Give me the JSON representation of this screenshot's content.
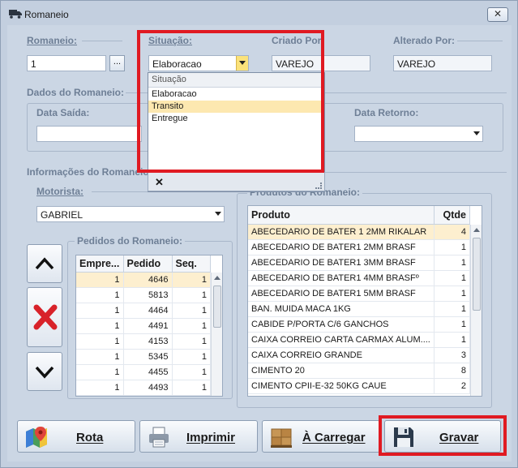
{
  "window": {
    "title": "Romaneio",
    "close_glyph": "✕"
  },
  "fields": {
    "romaneio": {
      "label": "Romaneio:",
      "value": "1",
      "button": "..."
    },
    "situacao": {
      "label": "Situação:",
      "value": "Elaboracao"
    },
    "criado_por": {
      "label": "Criado Por:",
      "value": "VAREJO"
    },
    "alterado_por": {
      "label": "Alterado Por:",
      "value": "VAREJO"
    }
  },
  "dados": {
    "title": "Dados do Romaneio:",
    "data_saida_label": "Data Saída:",
    "data_retorno_label": "Data Retorno:"
  },
  "situacao_dropdown": {
    "header": "Situação",
    "options": [
      "Elaboracao",
      "Transito",
      "Entregue"
    ],
    "highlighted": "Transito",
    "close_glyph": "✕"
  },
  "info": {
    "title": "Informações do Romaneio:",
    "motorista_label": "Motorista:",
    "motorista_value": "GABRIEL",
    "pedidos_label": "Pedidos do Romaneio:",
    "produtos_label": "Produtos do Romaneio:"
  },
  "pedidos": {
    "columns": [
      "Empre...",
      "Pedido",
      "Seq."
    ],
    "rows": [
      [
        "1",
        "4646",
        "1"
      ],
      [
        "1",
        "5813",
        "1"
      ],
      [
        "1",
        "4464",
        "1"
      ],
      [
        "1",
        "4491",
        "1"
      ],
      [
        "1",
        "4153",
        "1"
      ],
      [
        "1",
        "5345",
        "1"
      ],
      [
        "1",
        "4455",
        "1"
      ],
      [
        "1",
        "4493",
        "1"
      ]
    ]
  },
  "produtos": {
    "columns": [
      "Produto",
      "Qtde"
    ],
    "rows": [
      [
        "ABECEDARIO DE BATER 1 2MM RIKALAR",
        "4"
      ],
      [
        "ABECEDARIO DE BATER1 2MM BRASF",
        "1"
      ],
      [
        "ABECEDARIO DE BATER1 3MM BRASF",
        "1"
      ],
      [
        "ABECEDARIO DE BATER1 4MM BRASFº",
        "1"
      ],
      [
        "ABECEDARIO DE BATER1 5MM BRASF",
        "1"
      ],
      [
        "BAN. MUIDA MACA 1KG",
        "1"
      ],
      [
        "CABIDE P/PORTA C/6 GANCHOS",
        "1"
      ],
      [
        "CAIXA CORREIO CARTA CARMAX ALUM....",
        "1"
      ],
      [
        "CAIXA CORREIO GRANDE",
        "3"
      ],
      [
        "CIMENTO 20",
        "8"
      ],
      [
        "CIMENTO CPII-E-32 50KG CAUE",
        "2"
      ]
    ]
  },
  "buttons": {
    "rota": "Rota",
    "imprimir": "Imprimir",
    "carregar": "À Carregar",
    "gravar": "Gravar"
  },
  "colors": {
    "highlight_frame": "#e01a22",
    "selected_row": "#fdefcf"
  }
}
